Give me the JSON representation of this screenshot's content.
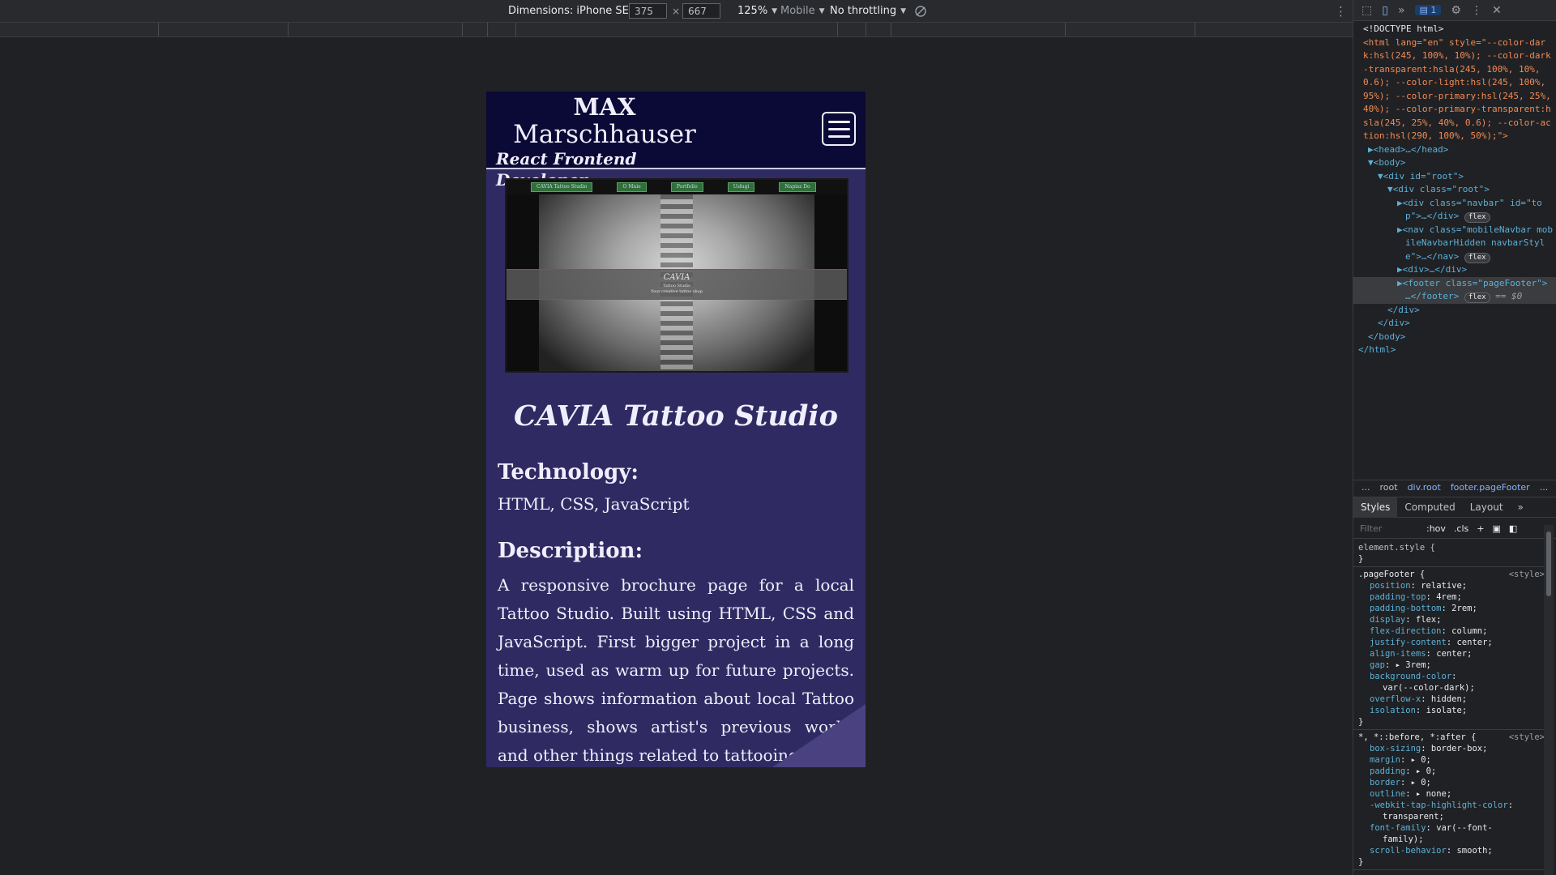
{
  "toolbar": {
    "dimensions_label": "Dimensions: iPhone SE",
    "width": "375",
    "height": "667",
    "times": "×",
    "zoom": "125%",
    "device_type": "Mobile",
    "throttling": "No throttling"
  },
  "site": {
    "brand_line1": "MAX",
    "brand_line2": "Marschhauser",
    "brand_line3": "React Frontend Developer",
    "project_title": "CAVIA Tattoo Studio",
    "preview": {
      "nav_items": [
        "CAVIA Tattoo Studio",
        "O Mnie",
        "Portfolio",
        "Usługi",
        "Napisz Do"
      ],
      "band_title": "CAVIA",
      "band_sub1": "Tattoo Studio",
      "band_sub2": "Your creative tattoo shop"
    },
    "tech_heading": "Technology:",
    "tech_value": "HTML,  CSS,  JavaScript",
    "desc_heading": "Description:",
    "description": "A responsive brochure page for a local Tattoo Studio. Built using HTML, CSS and JavaScript. First bigger project in a long time, used as warm up for future projects. Page shows information about local Tattoo business, shows artist's previous works and other things related to tattooing."
  },
  "devtools": {
    "issues_count": "1",
    "breadcrumbs": [
      "...",
      "root",
      "div.root",
      "footer.pageFooter",
      "..."
    ],
    "tabs": [
      "Styles",
      "Computed",
      "Layout"
    ],
    "filter_placeholder": "Filter",
    "hov": ":hov",
    "cls": ".cls",
    "elements_lines": [
      "<!DOCTYPE html>",
      "<html lang=\"en\" style=\"--color-dar",
      "k:hsl(245, 100%, 10%); --color-dark",
      "-transparent:hsla(245, 100%, 10%,",
      "0.6); --color-light:hsl(245, 100%,",
      "95%); --color-primary:hsl(245, 25%,",
      "40%); --color-primary-transparent:h",
      "sla(245, 25%, 40%, 0.6); --color-ac",
      "tion:hsl(290, 100%, 50%);\">",
      "▶<head>…</head>",
      "▼<body>",
      "▼<div id=\"root\">",
      "▼<div class=\"root\">",
      "▶<div class=\"navbar\" id=\"to",
      "p\">…</div>",
      "▶<nav class=\"mobileNavbar mob",
      "ileNavbarHidden navbarStyl",
      "e\">…</nav>",
      "▶<div>…</div>",
      "▶<footer class=\"pageFooter\">",
      "…</footer>",
      "</div>",
      "</div>",
      "</body>",
      "</html>"
    ],
    "flex_badge": "flex",
    "dollar0": "== $0",
    "element_style": "element.style {",
    "close_brace": "}",
    "rule1_selector": ".pageFooter {",
    "rule1_source": "<style>",
    "rule1_props": [
      [
        "position",
        "relative;"
      ],
      [
        "padding-top",
        "4rem;"
      ],
      [
        "padding-bottom",
        "2rem;"
      ],
      [
        "display",
        "flex;"
      ],
      [
        "flex-direction",
        "column;"
      ],
      [
        "justify-content",
        "center;"
      ],
      [
        "align-items",
        "center;"
      ],
      [
        "gap",
        "▸ 3rem;"
      ],
      [
        "background-color",
        ""
      ],
      [
        "",
        "var(--color-dark);"
      ],
      [
        "overflow-x",
        "hidden;"
      ],
      [
        "isolation",
        "isolate;"
      ]
    ],
    "rule2_selector": "*, *::before, *:after {",
    "rule2_source": "<style>",
    "rule2_props": [
      [
        "box-sizing",
        "border-box;"
      ],
      [
        "margin",
        "▸ 0;"
      ],
      [
        "padding",
        "▸ 0;"
      ],
      [
        "border",
        "▸ 0;"
      ],
      [
        "outline",
        "▸ none;"
      ],
      [
        "-webkit-tap-highlight-color",
        ""
      ],
      [
        "",
        "transparent;"
      ],
      [
        "font-family",
        "var(--font-"
      ],
      [
        "",
        "family);"
      ],
      [
        "scroll-behavior",
        "smooth;"
      ]
    ]
  },
  "colors": {
    "navbar_bg": "#0b0935",
    "page_bg": "#302a63",
    "text_light": "#f0eefc"
  }
}
